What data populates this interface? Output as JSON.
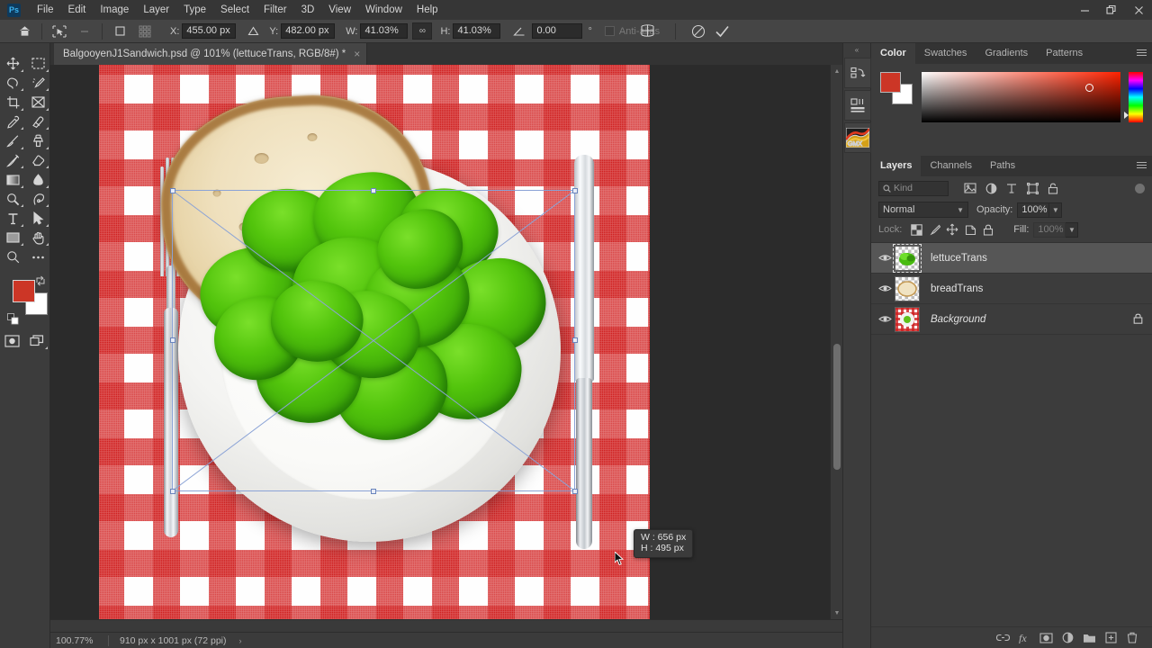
{
  "app": {
    "name": "Photoshop",
    "logo_text": "Ps"
  },
  "menubar": {
    "items": [
      {
        "label": "File"
      },
      {
        "label": "Edit"
      },
      {
        "label": "Image"
      },
      {
        "label": "Layer"
      },
      {
        "label": "Type"
      },
      {
        "label": "Select"
      },
      {
        "label": "Filter"
      },
      {
        "label": "3D"
      },
      {
        "label": "View"
      },
      {
        "label": "Window"
      },
      {
        "label": "Help"
      }
    ]
  },
  "window_controls": {
    "minimize": "minimize-icon",
    "restore": "restore-icon",
    "close": "close-icon"
  },
  "options_bar": {
    "home_icon": "home-icon",
    "transform_icon": "free-transform-icon",
    "ref_point_icon": "reference-point-icon",
    "x_label": "X:",
    "x_value": "455.00 px",
    "delta_icon": "delta-icon",
    "y_label": "Y:",
    "y_value": "482.00 px",
    "w_label": "W:",
    "w_value": "41.03%",
    "link_label": "∞",
    "h_label": "H:",
    "h_value": "41.03%",
    "angle_icon": "angle-icon",
    "angle_value": "0.00",
    "degree_symbol": "°",
    "antialias_label": "Anti-alias",
    "warp_icon": "warp-icon",
    "cancel_icon": "cancel-transform-icon",
    "commit_icon": "commit-transform-icon"
  },
  "top_right_icons": {
    "search": "search-icon",
    "arrange": "arrange-documents-icon",
    "share": "share-icon",
    "collapse": "»"
  },
  "toolbar": {
    "tools": [
      {
        "name": "move-tool"
      },
      {
        "name": "rectangular-marquee-tool"
      },
      {
        "name": "lasso-tool"
      },
      {
        "name": "quick-selection-tool"
      },
      {
        "name": "crop-tool"
      },
      {
        "name": "frame-tool"
      },
      {
        "name": "eyedropper-tool"
      },
      {
        "name": "spot-healing-brush-tool"
      },
      {
        "name": "brush-tool"
      },
      {
        "name": "clone-stamp-tool"
      },
      {
        "name": "history-brush-tool"
      },
      {
        "name": "eraser-tool"
      },
      {
        "name": "gradient-tool"
      },
      {
        "name": "blur-tool"
      },
      {
        "name": "dodge-tool"
      },
      {
        "name": "pen-tool"
      },
      {
        "name": "type-tool"
      },
      {
        "name": "path-selection-tool"
      },
      {
        "name": "rectangle-tool"
      },
      {
        "name": "hand-tool"
      },
      {
        "name": "zoom-tool"
      },
      {
        "name": "edit-toolbar-tool"
      }
    ],
    "foreground_color": "#cc3626",
    "background_color": "#ffffff",
    "quick_mask_icon": "quick-mask-icon",
    "screen_mode_icon": "screen-mode-icon"
  },
  "document": {
    "tab_title": "BalgooyenJ1Sandwich.psd @ 101% (lettuceTrans, RGB/8#) *",
    "close_icon": "×",
    "size_tooltip": {
      "w_label": "W :",
      "w_value": "656 px",
      "h_label": "H :",
      "h_value": "495 px"
    }
  },
  "status_bar": {
    "zoom": "100.77%",
    "doc_info": "910 px x 1001 px (72 ppi)",
    "expand_arrow": "›"
  },
  "rail": {
    "collapse": "«",
    "buttons": [
      {
        "name": "history-panel-icon",
        "label": "History"
      },
      {
        "name": "properties-panel-icon",
        "label": "Properties"
      },
      {
        "name": "gmx-panel-icon",
        "label": "GMX"
      }
    ]
  },
  "color_panel": {
    "tabs": [
      {
        "label": "Color",
        "active": true
      },
      {
        "label": "Swatches",
        "active": false
      },
      {
        "label": "Gradients",
        "active": false
      },
      {
        "label": "Patterns",
        "active": false
      }
    ],
    "foreground": "#cc3626",
    "background": "#ffffff",
    "hue_color": "#ff2200",
    "menu_icon": "panel-menu-icon"
  },
  "layers_panel": {
    "tabs": [
      {
        "label": "Layers",
        "active": true
      },
      {
        "label": "Channels",
        "active": false
      },
      {
        "label": "Paths",
        "active": false
      }
    ],
    "menu_icon": "panel-menu-icon",
    "filter": {
      "placeholder": "Kind",
      "search_icon": "search-icon",
      "icons": [
        {
          "name": "filter-pixel-icon"
        },
        {
          "name": "filter-adjustment-icon"
        },
        {
          "name": "filter-type-icon"
        },
        {
          "name": "filter-shape-icon"
        },
        {
          "name": "filter-smart-object-icon"
        }
      ],
      "toggle_icon": "filter-enable-toggle"
    },
    "blend_mode": "Normal",
    "opacity_label": "Opacity:",
    "opacity_value": "100%",
    "lock_label": "Lock:",
    "lock_icons": [
      {
        "name": "lock-transparent-pixels-icon"
      },
      {
        "name": "lock-image-pixels-icon"
      },
      {
        "name": "lock-position-icon"
      },
      {
        "name": "lock-artboard-nesting-icon"
      },
      {
        "name": "lock-all-icon"
      }
    ],
    "fill_label": "Fill:",
    "fill_value": "100%",
    "layers": [
      {
        "name": "lettuceTrans",
        "selected": true,
        "visible": true,
        "italic": false,
        "locked": false,
        "thumb": "lettuce"
      },
      {
        "name": "breadTrans",
        "selected": false,
        "visible": true,
        "italic": false,
        "locked": false,
        "thumb": "bread"
      },
      {
        "name": "Background",
        "selected": false,
        "visible": true,
        "italic": true,
        "locked": true,
        "thumb": "background"
      }
    ],
    "bottom_icons": [
      {
        "name": "link-layers-icon"
      },
      {
        "name": "layer-style-fx-icon"
      },
      {
        "name": "add-layer-mask-icon"
      },
      {
        "name": "new-adjustment-layer-icon"
      },
      {
        "name": "new-group-icon"
      },
      {
        "name": "new-layer-icon"
      },
      {
        "name": "delete-layer-icon"
      }
    ]
  }
}
